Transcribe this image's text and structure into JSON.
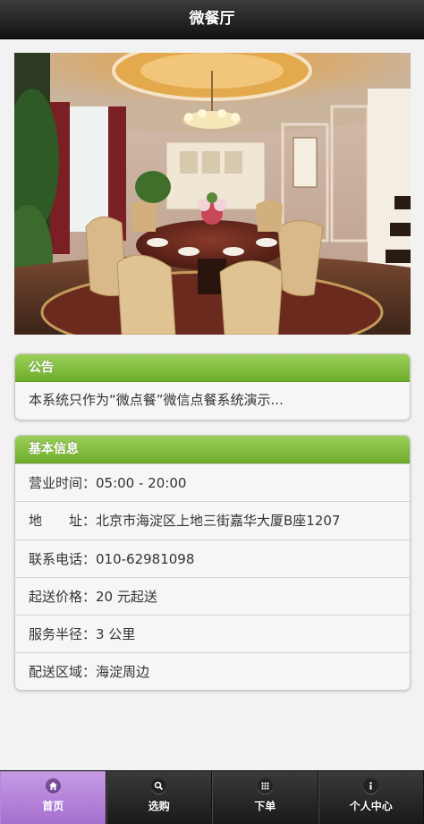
{
  "header": {
    "title": "微餐厅"
  },
  "notice": {
    "title": "公告",
    "text": "本系统只作为“微点餐”微信点餐系统演示..."
  },
  "info": {
    "title": "基本信息",
    "rows": [
      "营业时间：05:00 - 20:00",
      "地　　址：北京市海淀区上地三街嘉华大厦B座1207",
      "联系电话：010-62981098",
      "起送价格：20 元起送",
      "服务半径：3 公里",
      "配送区域：海淀周边"
    ]
  },
  "tabbar": {
    "tabs": [
      {
        "label": "首页",
        "icon": "home-icon",
        "active": true
      },
      {
        "label": "选购",
        "icon": "search-icon",
        "active": false
      },
      {
        "label": "下单",
        "icon": "grid-icon",
        "active": false
      },
      {
        "label": "个人中心",
        "icon": "info-icon",
        "active": false
      }
    ],
    "active_color": "#b07fd6"
  },
  "colors": {
    "header_bg": "#1a1a1a",
    "card_title_green": "#7dbb36",
    "background": "#f2f2f2"
  }
}
